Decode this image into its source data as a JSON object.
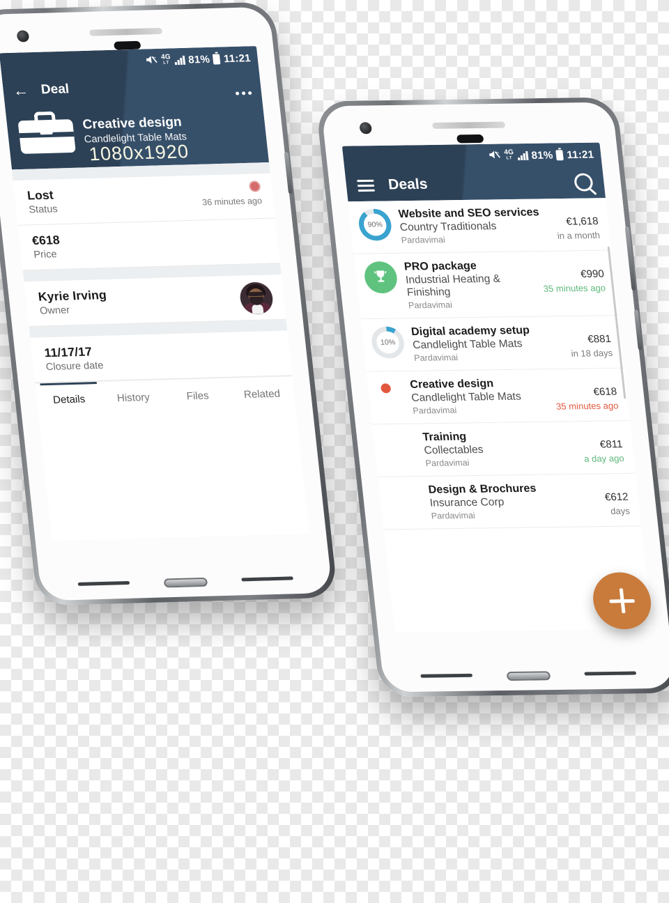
{
  "watermark": "1080x1920",
  "status_bar": {
    "network": "4G",
    "network_sub": "LT",
    "battery": "81%",
    "time": "11:21",
    "mute_icon": "mute-icon",
    "signal_icon": "signal-bars-icon",
    "battery_icon": "battery-icon"
  },
  "colors": {
    "navy": "#2d4156",
    "accent_orange": "#c97b3c",
    "ring_blue": "#3aa3cf",
    "badge_green": "#5fc37f",
    "status_red": "#d66b6b",
    "text_green": "#5fb87b",
    "text_red": "#e2583f"
  },
  "phone_left": {
    "appbar": {
      "back_label": "←",
      "title": "Deal",
      "overflow_label": "more-options"
    },
    "hero": {
      "icon": "briefcase-icon",
      "title": "Creative design",
      "subtitle": "Candlelight Table Mats"
    },
    "rows": [
      {
        "value": "Lost",
        "label": "Status",
        "meta": "36 minutes ago",
        "has_dot": true
      },
      {
        "value": "€618",
        "label": "Price",
        "meta": "",
        "has_dot": false
      },
      {
        "value": "Kyrie Irving",
        "label": "Owner",
        "meta": "",
        "has_avatar": true
      },
      {
        "value": "11/17/17",
        "label": "Closure date",
        "meta": "",
        "has_dot": false
      }
    ],
    "tabs": [
      {
        "label": "Details",
        "active": true
      },
      {
        "label": "History",
        "active": false
      },
      {
        "label": "Files",
        "active": false
      },
      {
        "label": "Related",
        "active": false
      }
    ]
  },
  "phone_right": {
    "appbar": {
      "menu_label": "menu",
      "title": "Deals",
      "search_label": "search"
    },
    "fab_label": "add-deal",
    "deals": [
      {
        "badge_type": "ring",
        "badge_text": "90%",
        "badge_percent": 90,
        "title": "Website and SEO services",
        "company": "Country Traditionals",
        "tag": "Pardavimai",
        "price": "€1,618",
        "when": "in a month",
        "when_color": "grey"
      },
      {
        "badge_type": "trophy",
        "badge_text": "",
        "badge_percent": 100,
        "title": "PRO package",
        "company": "Industrial Heating & Finishing",
        "tag": "Pardavimai",
        "price": "€990",
        "when": "35 minutes ago",
        "when_color": "green"
      },
      {
        "badge_type": "ring",
        "badge_text": "10%",
        "badge_percent": 10,
        "title": "Digital academy setup",
        "company": "Candlelight Table Mats",
        "tag": "Pardavimai",
        "price": "€881",
        "when": "in 18 days",
        "when_color": "grey"
      },
      {
        "badge_type": "dot",
        "badge_text": "",
        "badge_percent": 0,
        "title": "Creative design",
        "company": "Candlelight Table Mats",
        "tag": "Pardavimai",
        "price": "€618",
        "when": "35 minutes ago",
        "when_color": "red"
      },
      {
        "badge_type": "none",
        "badge_text": "",
        "badge_percent": 0,
        "title": "Training",
        "company": "Collectables",
        "tag": "Pardavimai",
        "price": "€811",
        "when": "a day ago",
        "when_color": "green"
      },
      {
        "badge_type": "none",
        "badge_text": "",
        "badge_percent": 0,
        "title": "Design & Brochures",
        "company": "Insurance Corp",
        "tag": "Pardavimai",
        "price": "€612",
        "when": "days",
        "when_color": "grey"
      }
    ]
  }
}
